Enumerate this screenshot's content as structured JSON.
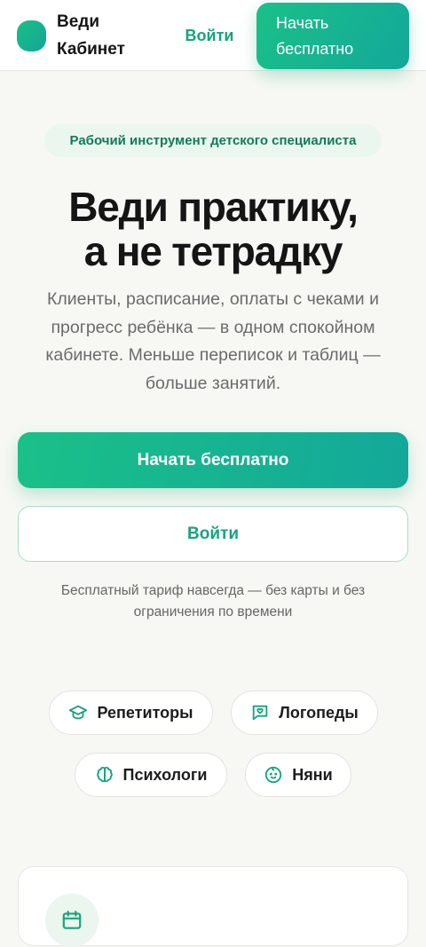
{
  "header": {
    "logo_line1": "Веди",
    "logo_line2": "Кабинет",
    "login_label": "Войти",
    "cta_line1": "Начать",
    "cta_line2": "бесплатно"
  },
  "hero": {
    "badge": "Рабочий инструмент детского специалиста",
    "title_line1": "Веди практику,",
    "title_line2": "а не тетрадку",
    "subtitle": "Клиенты, расписание, оплаты с чеками и прогресс ребёнка — в одном спокойном кабинете. Меньше переписок и таблиц — больше занятий.",
    "primary_cta": "Начать бесплатно",
    "secondary_cta": "Войти",
    "note": "Бесплатный тариф навсегда — без карты и без ограничения по времени"
  },
  "audience": [
    {
      "label": "Репетиторы",
      "icon": "graduation-cap-icon"
    },
    {
      "label": "Логопеды",
      "icon": "speech-bubble-icon"
    },
    {
      "label": "Психологи",
      "icon": "brain-icon"
    },
    {
      "label": "Няни",
      "icon": "baby-face-icon"
    }
  ],
  "card": {
    "icon": "calendar-icon"
  },
  "colors": {
    "accent": "#16a47d",
    "gradient_start": "#1ac088",
    "gradient_end": "#13a89a",
    "background": "#f7f8f3"
  }
}
